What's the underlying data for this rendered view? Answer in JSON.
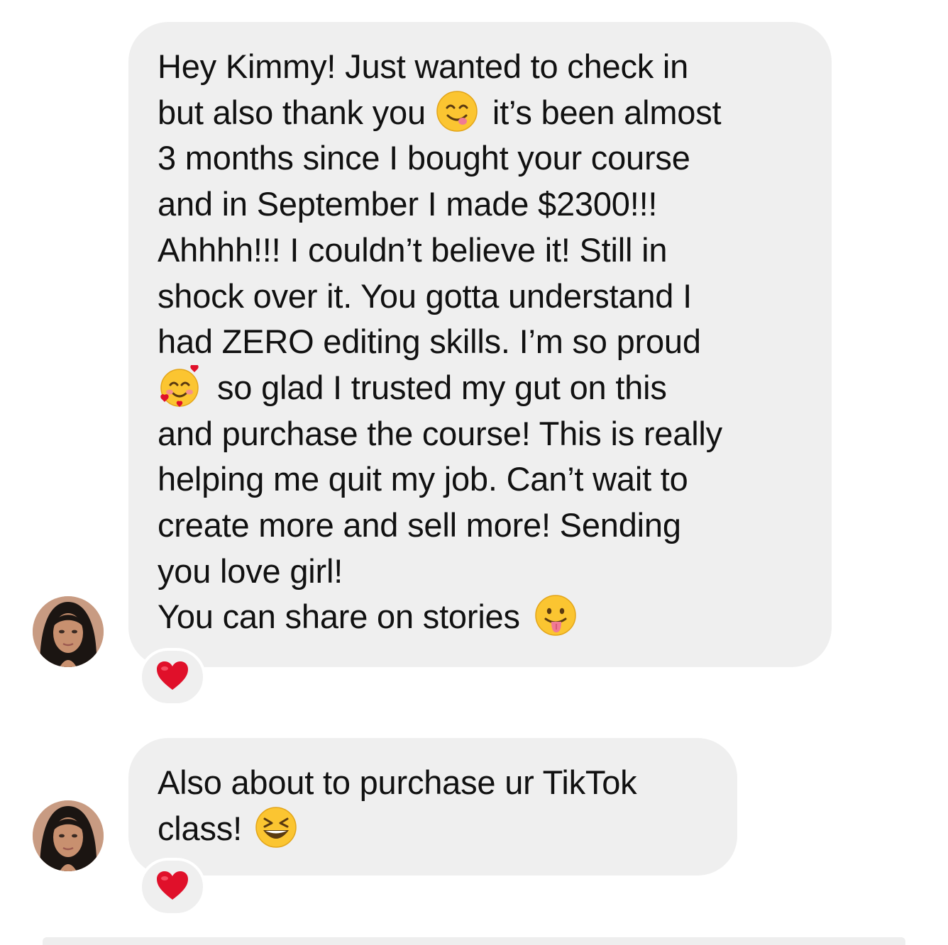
{
  "messages": [
    {
      "lines": [
        {
          "text": "Hey Kimmy! Just wanted to check in"
        },
        {
          "before": "but also thank you",
          "emoji": "savoring-face-emoji",
          "after": "it’s been almost"
        },
        {
          "text": "3 months since I bought your course"
        },
        {
          "text": "and in September I made $2300!!!"
        },
        {
          "text": "Ahhhh!!! I couldn’t believe it! Still in"
        },
        {
          "text": "shock over it. You gotta understand I"
        },
        {
          "text": "had ZERO editing skills. I’m so proud"
        },
        {
          "emoji_lead": "smiling-face-with-hearts-emoji",
          "after": "so glad I trusted my gut on this"
        },
        {
          "text": "and purchase the course! This is really"
        },
        {
          "text": "helping me quit my job. Can’t wait to"
        },
        {
          "text": "create more and sell more! Sending"
        },
        {
          "text": "you love girl!"
        },
        {
          "before": "You can share on stories",
          "emoji": "face-with-tongue-emoji"
        }
      ],
      "reaction": "heart-emoji"
    },
    {
      "lines": [
        {
          "text": "Also about to purchase ur TikTok"
        },
        {
          "before": "class!",
          "emoji": "grinning-squinting-face-emoji"
        }
      ],
      "reaction": "heart-emoji"
    }
  ],
  "colors": {
    "bubble": "#efefef",
    "text": "#111111",
    "heart": "#e0102a",
    "emoji_yellow": "#fbc531"
  }
}
